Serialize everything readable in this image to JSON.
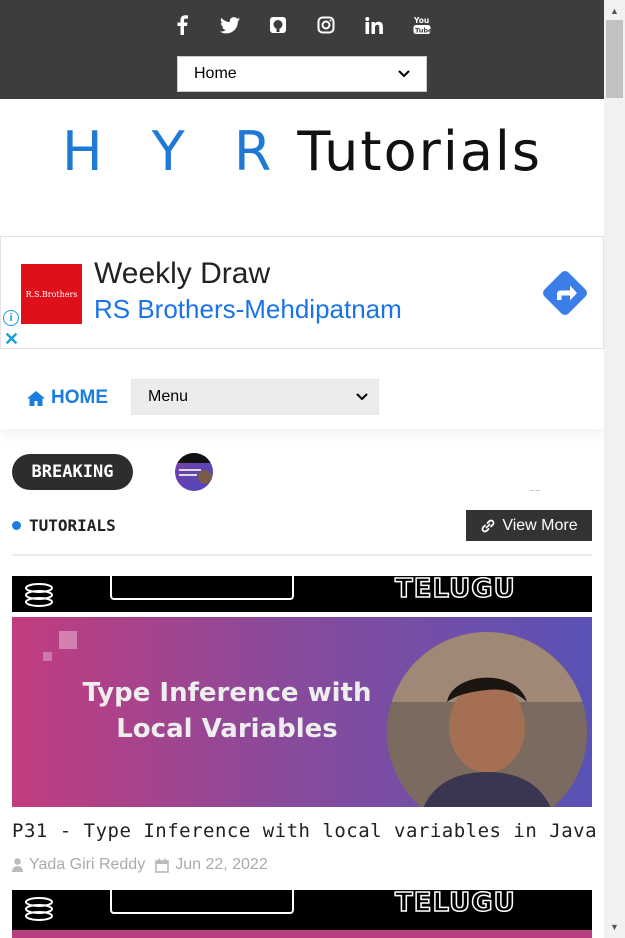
{
  "social": [
    "f",
    "𝕏",
    "⌘",
    "◎",
    "in",
    "You\nTube"
  ],
  "top_select": {
    "value": "Home"
  },
  "logo": {
    "hyr": "H Y R",
    "tutorials": "Tutorials"
  },
  "ad": {
    "logo_text": "R.S.Brothers",
    "title": "Weekly Draw",
    "subtitle": "RS Brothers-Mehdipatnam"
  },
  "nav": {
    "home_label": "HOME",
    "menu_value": "Menu"
  },
  "breaking": {
    "label": "BREAKING"
  },
  "section": {
    "title": "TUTORIALS",
    "view_more": "View More"
  },
  "strip": {
    "label": "TELUGU"
  },
  "post": {
    "banner_line1": "Type Inference with",
    "banner_line2": "Local Variables",
    "title": "P31 - Type Inference with local variables in Java",
    "author": "Yada Giri Reddy",
    "date": "Jun 22, 2022"
  },
  "colors": {
    "accent": "#1a7ee0",
    "topbar": "#3d3d3d"
  }
}
